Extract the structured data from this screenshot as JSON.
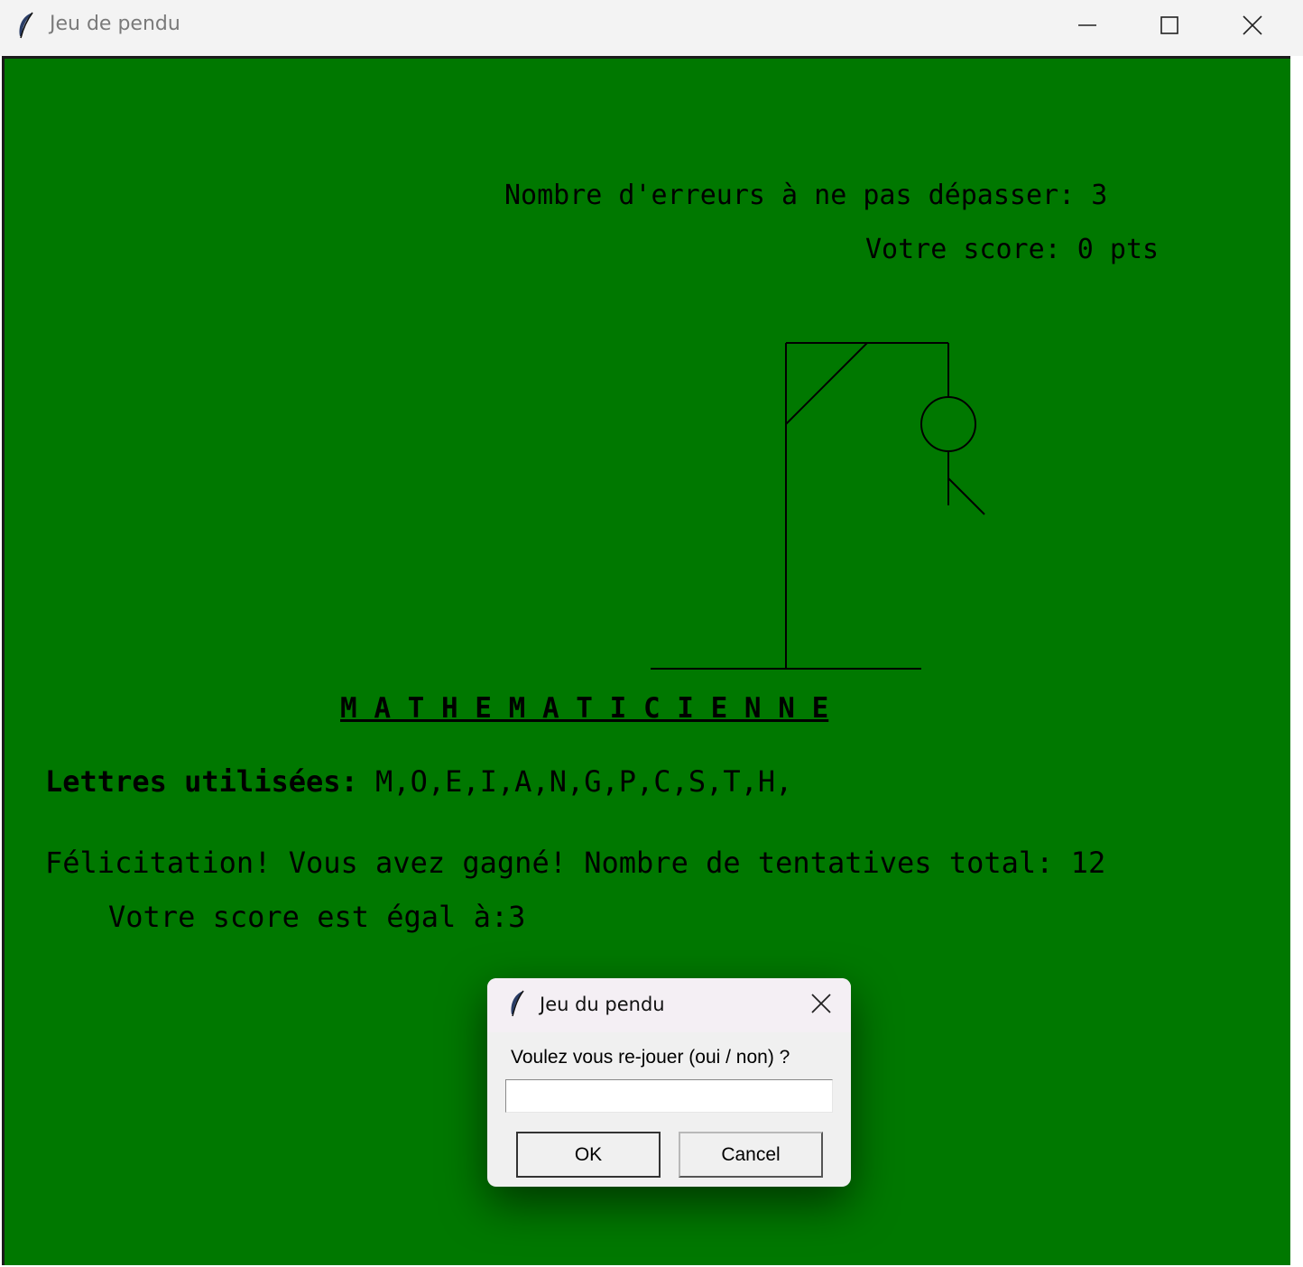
{
  "window": {
    "title": "Jeu de pendu"
  },
  "game": {
    "errors_limit_text": "Nombre d'erreurs à ne pas dépasser: 3",
    "score_text": "Votre score: 0 pts",
    "word_display": "M A T H E M A T I C I E N N E",
    "used_letters_label": "Lettres utilisées: ",
    "used_letters": "M,O,E,I,A,N,G,P,C,S,T,H,",
    "win_message": "Félicitation! Vous avez gagné! Nombre de tentatives total: 12",
    "final_score_text": "Votre score est égal à:3",
    "canvas_color": "#007800"
  },
  "dialog": {
    "title": "Jeu du pendu",
    "prompt": "Voulez vous re-jouer (oui / non) ?",
    "input_value": "",
    "ok_label": "OK",
    "cancel_label": "Cancel"
  }
}
